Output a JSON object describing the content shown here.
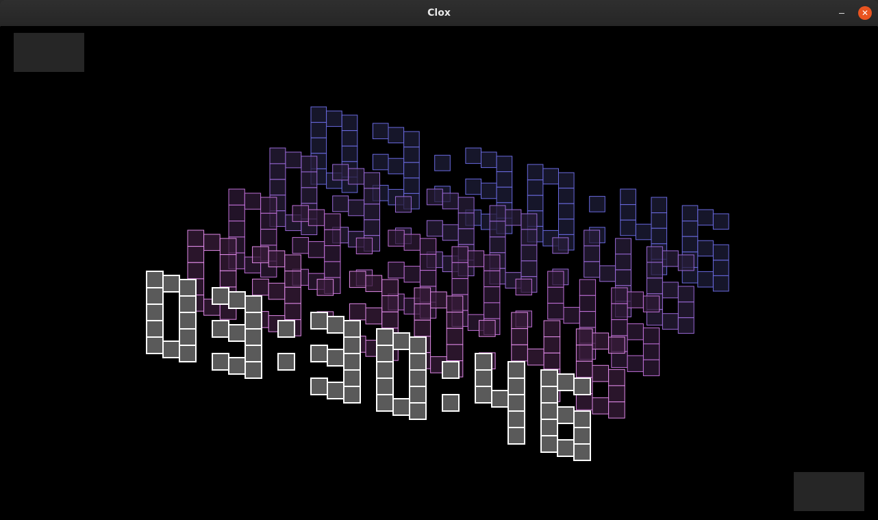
{
  "window": {
    "title": "Clox",
    "close_glyph": "✕",
    "minimize_icon": "minimize-icon",
    "close_icon": "close-icon"
  },
  "clock": {
    "time_text": "03:30:46",
    "digit_font": {
      "0": [
        "111",
        "101",
        "101",
        "101",
        "111"
      ],
      "3": [
        "111",
        "001",
        "111",
        "001",
        "111"
      ],
      "4": [
        "101",
        "101",
        "111",
        "001",
        "001"
      ],
      "6": [
        "111",
        "100",
        "111",
        "101",
        "111"
      ],
      ":": [
        "0",
        "1",
        "0",
        "1",
        "0"
      ]
    },
    "layers": [
      {
        "color": "#6a6ae0",
        "fill": "#1e1e38"
      },
      {
        "color": "#9a6ad8",
        "fill": "#281e3a"
      },
      {
        "color": "#c070d8",
        "fill": "#2e1a36"
      },
      {
        "color": "#e08ae8",
        "fill": "#381c3a"
      },
      {
        "color": "#ffffff",
        "fill": "#5a5a5a"
      }
    ]
  }
}
